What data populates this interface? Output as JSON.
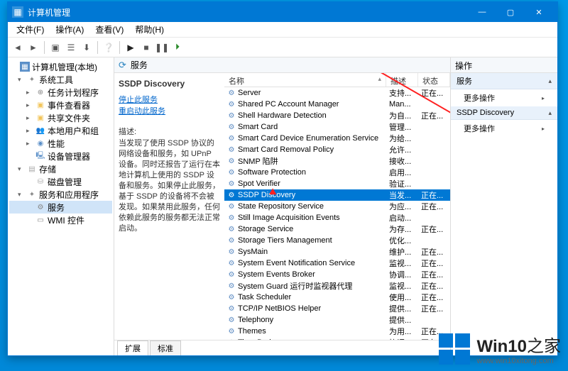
{
  "window": {
    "title": "计算机管理",
    "controls": {
      "min": "—",
      "max": "▢",
      "close": "✕"
    }
  },
  "menubar": [
    {
      "label": "文件(F)"
    },
    {
      "label": "操作(A)"
    },
    {
      "label": "查看(V)"
    },
    {
      "label": "帮助(H)"
    }
  ],
  "tree": {
    "root": "计算机管理(本地)",
    "system_tools": "系统工具",
    "system_tools_items": [
      "任务计划程序",
      "事件查看器",
      "共享文件夹",
      "本地用户和组",
      "性能",
      "设备管理器"
    ],
    "storage": "存储",
    "storage_items": [
      "磁盘管理"
    ],
    "services_apps": "服务和应用程序",
    "services_apps_items": [
      "服务",
      "WMI 控件"
    ]
  },
  "center": {
    "header": "服务",
    "selected_title": "SSDP Discovery",
    "link_stop": "停止此服务",
    "link_restart": "重启动此服务",
    "desc_label": "描述:",
    "desc_body": "当发现了使用 SSDP 协议的网络设备和服务，如 UPnP 设备。同时还报告了运行在本地计算机上使用的 SSDP 设备和服务。如果停止此服务，基于 SSDP 的设备将不会被发现。如果禁用此服务，任何依赖此服务的服务都无法正常启动。",
    "columns": {
      "name": "名称",
      "desc": "描述",
      "status": "状态"
    },
    "rows": [
      {
        "name": "Server",
        "desc": "支持...",
        "status": "正在..."
      },
      {
        "name": "Shared PC Account Manager",
        "desc": "Man...",
        "status": ""
      },
      {
        "name": "Shell Hardware Detection",
        "desc": "为自...",
        "status": "正在..."
      },
      {
        "name": "Smart Card",
        "desc": "管理...",
        "status": ""
      },
      {
        "name": "Smart Card Device Enumeration Service",
        "desc": "为给...",
        "status": ""
      },
      {
        "name": "Smart Card Removal Policy",
        "desc": "允许...",
        "status": ""
      },
      {
        "name": "SNMP 陷阱",
        "desc": "接收...",
        "status": ""
      },
      {
        "name": "Software Protection",
        "desc": "启用...",
        "status": ""
      },
      {
        "name": "Spot Verifier",
        "desc": "验证...",
        "status": ""
      },
      {
        "name": "SSDP Discovery",
        "desc": "当发...",
        "status": "正在...",
        "selected": true
      },
      {
        "name": "State Repository Service",
        "desc": "为应...",
        "status": "正在..."
      },
      {
        "name": "Still Image Acquisition Events",
        "desc": "启动...",
        "status": ""
      },
      {
        "name": "Storage Service",
        "desc": "为存...",
        "status": "正在..."
      },
      {
        "name": "Storage Tiers Management",
        "desc": "优化...",
        "status": ""
      },
      {
        "name": "SysMain",
        "desc": "维护...",
        "status": "正在..."
      },
      {
        "name": "System Event Notification Service",
        "desc": "监视...",
        "status": "正在..."
      },
      {
        "name": "System Events Broker",
        "desc": "协调...",
        "status": "正在..."
      },
      {
        "name": "System Guard 运行时监视器代理",
        "desc": "监视...",
        "status": "正在..."
      },
      {
        "name": "Task Scheduler",
        "desc": "使用...",
        "status": "正在..."
      },
      {
        "name": "TCP/IP NetBIOS Helper",
        "desc": "提供...",
        "status": "正在..."
      },
      {
        "name": "Telephony",
        "desc": "提供...",
        "status": ""
      },
      {
        "name": "Themes",
        "desc": "为用...",
        "status": "正在..."
      },
      {
        "name": "Time Broker",
        "desc": "协调...",
        "status": "正在..."
      }
    ],
    "tabs": {
      "extended": "扩展",
      "standard": "标准"
    }
  },
  "actions": {
    "header": "操作",
    "sect1": "服务",
    "more1": "更多操作",
    "sect2": "SSDP Discovery",
    "more2": "更多操作"
  },
  "watermark": {
    "brand_a": "Win10",
    "brand_b": "之家",
    "url": "www.win10xitong.com"
  }
}
